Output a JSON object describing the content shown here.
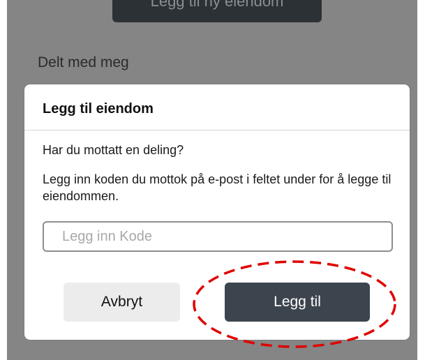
{
  "background": {
    "top_button_label": "Legg til ny eiendom",
    "section_title": "Delt med meg"
  },
  "dialog": {
    "title": "Legg til eiendom",
    "question": "Har du mottatt en deling?",
    "instructions": "Legg inn koden du mottok på e-post i feltet under for å legge til eiendommen.",
    "code_input": {
      "value": "",
      "placeholder": "Legg inn Kode"
    },
    "cancel_label": "Avbryt",
    "add_label": "Legg til"
  },
  "colors": {
    "overlay": "#858585",
    "primary_button": "#3c454e",
    "secondary_button": "#ececec",
    "annotation": "#e00000"
  }
}
